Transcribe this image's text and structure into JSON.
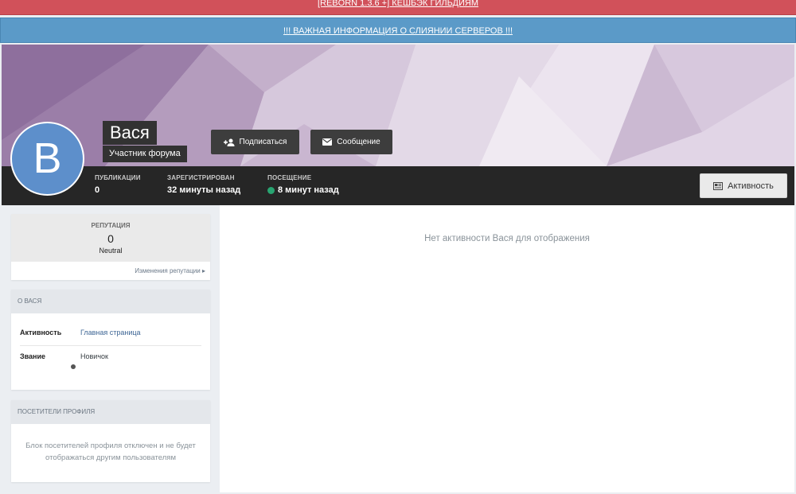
{
  "banners": {
    "top": "[REBORN 1.3.6 +] КЕШБЭК ГИЛЬДИЯМ",
    "second": "!!! ВАЖНАЯ ИНФОРМАЦИЯ О СЛИЯНИИ СЕРВЕРОВ !!!"
  },
  "profile": {
    "avatar_letter": "B",
    "name": "Вася",
    "group": "Участник форума",
    "follow_label": "Подписаться",
    "message_label": "Сообщение",
    "activity_label": "Активность",
    "avatar_color": "#5d8fcb"
  },
  "stats": [
    {
      "label": "ПУБЛИКАЦИИ",
      "value": "0"
    },
    {
      "label": "ЗАРЕГИСТРИРОВАН",
      "value": "32 минуты назад"
    },
    {
      "label": "ПОСЕЩЕНИЕ",
      "value": "8 минут назад",
      "online": true
    }
  ],
  "reputation": {
    "label": "РЕПУТАЦИЯ",
    "value": "0",
    "word": "Neutral",
    "changes_link": "Изменения репутации"
  },
  "about": {
    "title": "О ВАСЯ",
    "rows": [
      {
        "key": "Активность",
        "value": "Главная страница"
      },
      {
        "key": "Звание",
        "value": "Новичок"
      }
    ]
  },
  "visitors": {
    "title": "ПОСЕТИТЕЛИ ПРОФИЛЯ",
    "text": "Блок посетителей профиля отключен и не будет отображаться другим пользователям"
  },
  "content": {
    "empty_message": "Нет активности Вася для отображения"
  }
}
